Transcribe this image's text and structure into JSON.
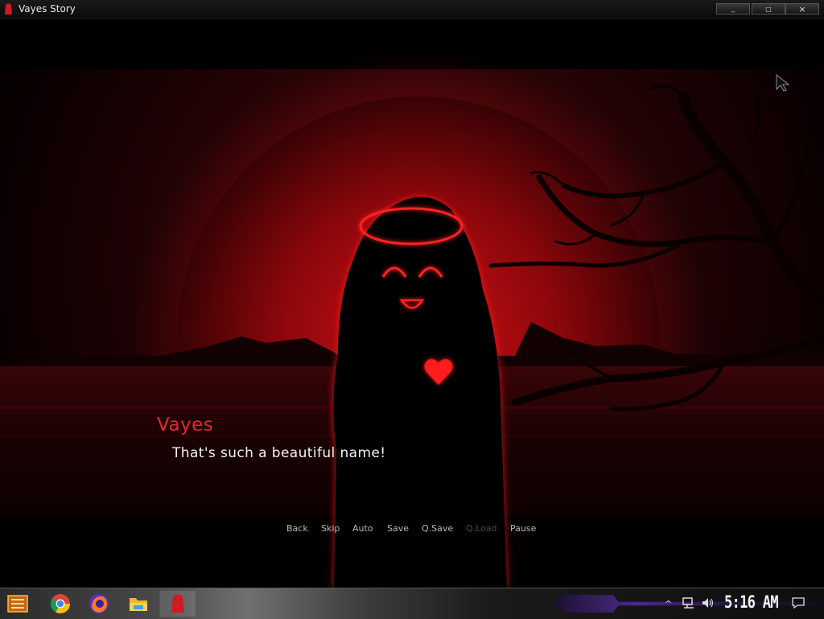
{
  "window": {
    "title": "Vayes Story",
    "minimize_label": "_",
    "maximize_label": "□",
    "close_label": "×"
  },
  "dialogue": {
    "speaker": "Vayes",
    "text": "That's such a beautiful name!"
  },
  "quick_menu": [
    {
      "label": "Back",
      "enabled": true
    },
    {
      "label": "Skip",
      "enabled": true
    },
    {
      "label": "Auto",
      "enabled": true
    },
    {
      "label": "Save",
      "enabled": true
    },
    {
      "label": "Q.Save",
      "enabled": true
    },
    {
      "label": "Q.Load",
      "enabled": false
    },
    {
      "label": "Pause",
      "enabled": true
    }
  ],
  "taskbar": {
    "apps": [
      "start-icon",
      "chrome-icon",
      "firefox-icon",
      "file-explorer-icon",
      "vayes-story-icon"
    ],
    "clock": "5:16 AM",
    "tray": [
      "show-hidden-icons",
      "network-icon",
      "volume-icon",
      "notification-icon"
    ]
  },
  "colors": {
    "accent_red": "#e3262f",
    "background": "#000000",
    "dialogue_text": "#f2f2f2",
    "disabled_menu": "#4a4a4a"
  }
}
